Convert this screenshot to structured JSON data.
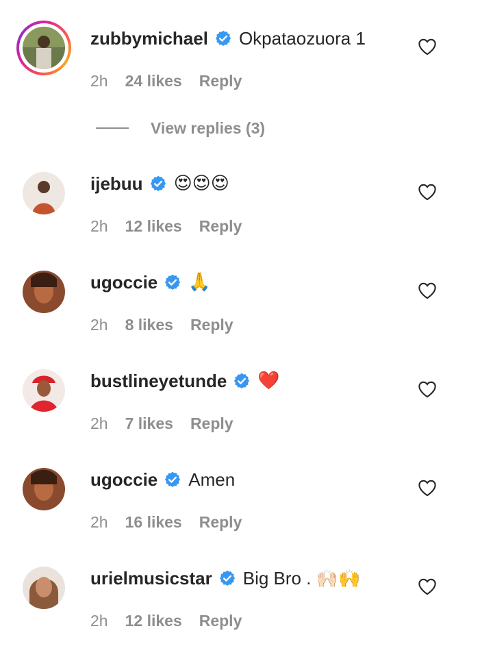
{
  "comments": [
    {
      "username": "zubbymichael",
      "text": "Okpataozuora 1",
      "time": "2h",
      "likes": "24 likes",
      "reply": "Reply",
      "has_story_ring": true,
      "view_replies": "View replies (3)"
    },
    {
      "username": "ijebuu",
      "text": "😍😍😍",
      "time": "2h",
      "likes": "12 likes",
      "reply": "Reply"
    },
    {
      "username": "ugoccie",
      "text": "🙏",
      "time": "2h",
      "likes": "8 likes",
      "reply": "Reply"
    },
    {
      "username": "bustlineyetunde",
      "text": "❤️",
      "time": "2h",
      "likes": "7 likes",
      "reply": "Reply"
    },
    {
      "username": "ugoccie",
      "text": "Amen",
      "time": "2h",
      "likes": "16 likes",
      "reply": "Reply"
    },
    {
      "username": "urielmusicstar",
      "text": "Big Bro . 🙌🏻🙌",
      "time": "2h",
      "likes": "12 likes",
      "reply": "Reply"
    }
  ],
  "icons": {
    "verified": "verified-badge-icon",
    "like": "heart-outline-icon"
  },
  "colors": {
    "text": "#262626",
    "secondary": "#8e8e8e",
    "verified": "#3897f0"
  }
}
